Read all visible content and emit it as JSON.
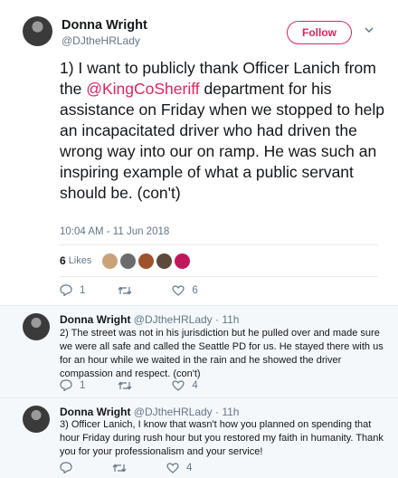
{
  "tweet": {
    "author_name": "Donna Wright",
    "author_handle": "@DJtheHRLady",
    "follow_label": "Follow",
    "text_before": "1) I want to publicly thank Officer Lanich from the ",
    "mention": "@KingCoSheriff",
    "text_after": " department for his assistance on Friday when we stopped to help an incapacitated driver who had driven the wrong way into our on ramp. He was such an inspiring example of what a public servant should be. (con't)",
    "timestamp": "10:04 AM - 11 Jun 2018",
    "likes_count": "6",
    "likes_label": "Likes",
    "reply_count": "1",
    "retweet_count": "",
    "like_count": "6"
  },
  "replies": [
    {
      "name": "Donna Wright",
      "handle": "@DJtheHRLady",
      "time": "· 11h",
      "text": "2) The street was not in his jurisdiction but he pulled over and made sure we were all safe and called the Seattle PD for us. He stayed there with us for an hour while we waited in the rain and he showed the driver compassion and respect. (con't)",
      "reply_count": "1",
      "like_count": "4"
    },
    {
      "name": "Donna Wright",
      "handle": "@DJtheHRLady",
      "time": "· 11h",
      "text": "3) Officer Lanich, I know that wasn't how you planned on spending that hour Friday during rush hour but you restored my faith in humanity. Thank you for your professionalism and your service!",
      "reply_count": "",
      "like_count": "4"
    }
  ],
  "colors": {
    "accent": "#e0245e",
    "muted": "#657786",
    "reply_bg": "#f5f8fa"
  }
}
